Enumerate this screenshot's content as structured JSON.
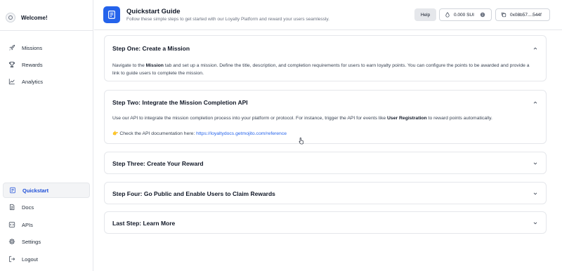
{
  "sidebar": {
    "brand": "Welcome!",
    "top_items": [
      {
        "label": "Missions",
        "icon": "rocket-icon"
      },
      {
        "label": "Rewards",
        "icon": "trophy-icon"
      },
      {
        "label": "Analytics",
        "icon": "chart-line-icon"
      }
    ],
    "bottom_items": [
      {
        "label": "Quickstart",
        "icon": "quickstart-icon",
        "active": true
      },
      {
        "label": "Docs",
        "icon": "document-icon"
      },
      {
        "label": "APIs",
        "icon": "code-icon"
      },
      {
        "label": "Settings",
        "icon": "gear-icon"
      },
      {
        "label": "Logout",
        "icon": "logout-icon"
      }
    ]
  },
  "header": {
    "title": "Quickstart Guide",
    "subtitle": "Follow these simple steps to get started with our Loyalty Platform and reward your users seamlessly.",
    "help_label": "Help",
    "balance": "0.000 SUI",
    "wallet": "0x08b57....544f"
  },
  "steps": [
    {
      "title": "Step One: Create a Mission",
      "expanded": true,
      "body_parts": [
        "Navigate to the ",
        "Mission",
        " tab and set up a mission. Define the title, description, and completion requirements for users to earn loyalty points. You can configure the points to be awarded and provide a link to guide users to complete the mission."
      ]
    },
    {
      "title": "Step Two: Integrate the Mission Completion API",
      "expanded": true,
      "body_parts": [
        "Use our API to integrate the mission completion process into your platform or protocol. For instance, trigger the API for events like ",
        "User Registration",
        " to reward points automatically."
      ],
      "doc_prefix": "👉 Check the API documentation here: ",
      "doc_link": "https://loyaltydocs.getmojito.com/reference"
    },
    {
      "title": "Step Three: Create Your Reward",
      "expanded": false
    },
    {
      "title": "Step Four: Go Public and Enable Users to Claim Rewards",
      "expanded": false
    },
    {
      "title": "Last Step: Learn More",
      "expanded": false
    }
  ],
  "colors": {
    "accent": "#2563eb",
    "border": "#e5e7eb"
  }
}
